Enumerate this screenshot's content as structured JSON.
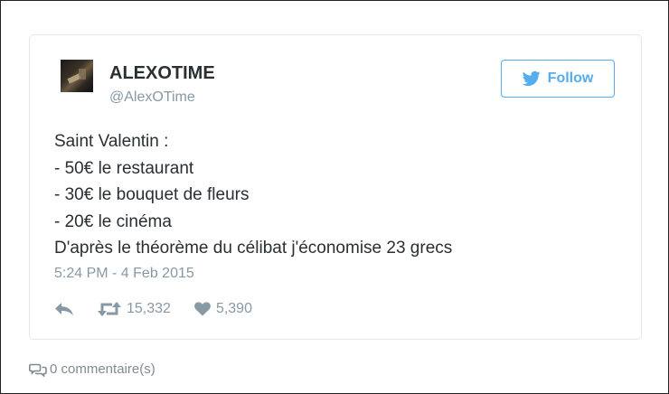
{
  "tweet": {
    "author_name": "ALEXOTIME",
    "author_handle": "@AlexOTime",
    "follow_label": "Follow",
    "text_lines": [
      "Saint Valentin :",
      "- 50€ le restaurant",
      "- 30€ le bouquet de fleurs",
      "- 20€ le cinéma",
      "D'après le théorème du célibat j'économise 23 grecs"
    ],
    "timestamp": "5:24 PM - 4 Feb 2015",
    "retweet_count": "15,332",
    "like_count": "5,390"
  },
  "comments": {
    "label": "0 commentaire(s)"
  },
  "colors": {
    "twitter_blue": "#55acee",
    "text": "#292f33",
    "muted": "#8899a6"
  },
  "icons": [
    "twitter-bird-icon",
    "reply-icon",
    "retweet-icon",
    "heart-icon",
    "comment-bubbles-icon"
  ]
}
